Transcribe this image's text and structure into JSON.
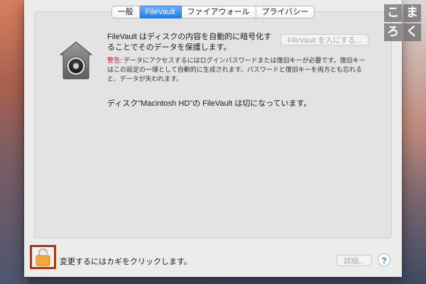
{
  "tabs": [
    {
      "label": "一般",
      "selected": false
    },
    {
      "label": "FileVault",
      "selected": true
    },
    {
      "label": "ファイアウォール",
      "selected": false
    },
    {
      "label": "プライバシー",
      "selected": false
    }
  ],
  "filevault": {
    "headline": "FileVault はディスクの内容を自動的に暗号化することでそのデータを保護します。",
    "enable_button_label": "FileVault を入にする...",
    "warning_label": "警告",
    "warning_text": ": データにアクセスするにはログインパスワードまたは復旧キーが必要です。復旧キーはこの設定の一環として自動的に生成されます。パスワードと復旧キーを両方とも忘れると、データが失われます。",
    "status_text": "ディスク\"Macintosh HD\"の FileVault は切になっています。"
  },
  "footer": {
    "lock_text": "変更するにはカギをクリックします。",
    "details_button_label": "詳細...",
    "help_label": "?"
  },
  "watermark": [
    "こ",
    "ま",
    "ろ",
    "く"
  ],
  "colors": {
    "accent": "#1e7bf3",
    "warning": "#d0191f",
    "highlight_border": "#a33a17",
    "lock_icon": "#f2a93b"
  },
  "icons": {
    "filevault": "filevault-house-lock-icon",
    "footer_lock": "padlock-open-icon"
  }
}
